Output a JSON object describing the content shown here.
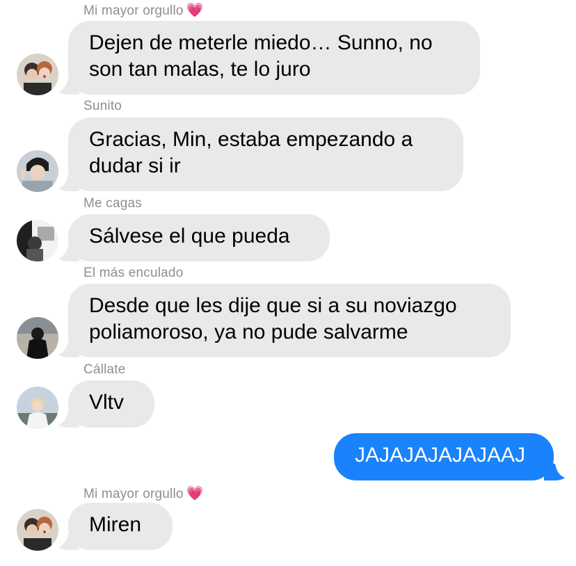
{
  "colors": {
    "incoming_bubble": "#e9e9eb",
    "outgoing_bubble": "#1a82fb",
    "sender_name": "#8e8e93",
    "heart": "#e64ca0"
  },
  "messages": [
    {
      "sender": "Mi mayor orgullo",
      "sender_emoji": "💗",
      "text": "Dejen de meterle miedo… Sunno, no son tan malas, te lo juro",
      "direction": "incoming"
    },
    {
      "sender": "Sunito",
      "text": "Gracias, Min, estaba empezando a dudar si ir",
      "direction": "incoming"
    },
    {
      "sender": "Me cagas",
      "text": "Sálvese el que pueda",
      "direction": "incoming"
    },
    {
      "sender": "El más enculado",
      "text": "Desde que les dije que si a su noviazgo poliamoroso, ya no pude salvarme",
      "direction": "incoming"
    },
    {
      "sender": "Cállate",
      "text": "Vltv",
      "direction": "incoming"
    },
    {
      "text": "JAJAJAJAJAJAAJ",
      "direction": "outgoing"
    },
    {
      "sender": "Mi mayor orgullo",
      "sender_emoji": "💗",
      "text": "Miren",
      "direction": "incoming"
    }
  ]
}
